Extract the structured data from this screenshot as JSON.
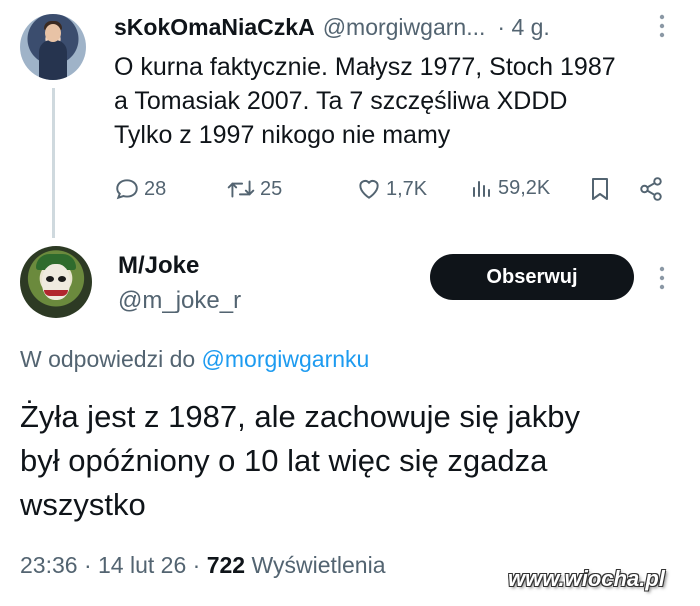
{
  "tweet1": {
    "author_name": "sKokOmaNiaCzkA",
    "handle": "@morgiwgarn...",
    "separator": "·",
    "time": "4 g.",
    "more_icon": "more-vertical-icon",
    "body_lines": [
      "O kurna faktycznie. Małysz 1977, Stoch 1987",
      "a Tomasiak 2007. Ta 7 szczęśliwa XDDD",
      "Tylko z 1997 nikogo nie mamy"
    ],
    "actions": {
      "replies": "28",
      "retweets": "25",
      "likes": "1,7K",
      "views": "59,2K"
    },
    "icons": [
      "reply-icon",
      "retweet-icon",
      "like-icon",
      "views-icon",
      "bookmark-icon",
      "share-icon"
    ]
  },
  "tweet2": {
    "author_name": "M/Joke",
    "handle": "@m_joke_r",
    "follow_label": "Obserwuj",
    "reply_prefix": "W odpowiedzi do",
    "reply_mention": "@morgiwgarnku",
    "body_lines": [
      "Żyła jest z 1987, ale zachowuje się jakby",
      "był opóźniony o 10 lat więc się zgadza",
      "wszystko"
    ],
    "meta": {
      "time": "23:36",
      "date": "14 lut 26",
      "separator": "·",
      "views_count": "722",
      "views_label": "Wyświetlenia"
    }
  },
  "watermark": "www.wiocha.pl",
  "colors": {
    "text_primary": "#0f1419",
    "text_secondary": "#536471",
    "accent": "#1d9bf0",
    "button_bg": "#0f1419",
    "thread_line": "#cfd9de"
  }
}
